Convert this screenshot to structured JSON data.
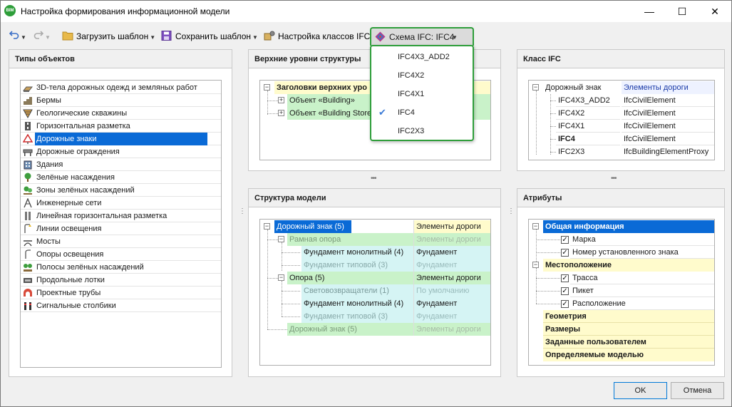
{
  "window": {
    "title": "Настройка формирования информационной модели",
    "app_badge": "BIM",
    "minimize": "—",
    "maximize": "☐",
    "close": "✕"
  },
  "toolbar": {
    "load_template": "Загрузить шаблон",
    "save_template": "Сохранить шаблон",
    "class_settings": "Настройка классов IFC",
    "schema_button": "Схема IFC: IFC4"
  },
  "schema_menu": {
    "items": [
      "IFC4X3_ADD2",
      "IFC4X2",
      "IFC4X1",
      "IFC4",
      "IFC2X3"
    ],
    "checked": "IFC4"
  },
  "object_types": {
    "title": "Типы объектов",
    "items": [
      "3D-тела дорожных одежд и земляных работ",
      "Бермы",
      "Геологические скважины",
      "Горизонтальная разметка",
      "Дорожные знаки",
      "Дорожные ограждения",
      "Здания",
      "Зелёные насаждения",
      "Зоны зелёных насаждений",
      "Инженерные сети",
      "Линейная горизонтальная разметка",
      "Линии освещения",
      "Мосты",
      "Опоры освещения",
      "Полосы зелёных насаждений",
      "Продольные лотки",
      "Проектные трубы",
      "Сигнальные столбики"
    ],
    "selected": "Дорожные знаки"
  },
  "upper_levels": {
    "title": "Верхние уровни структуры",
    "root": "Заголовки верхних уро",
    "children": [
      "Объект «Building»",
      "Объект «Building Store"
    ]
  },
  "ifc_class": {
    "title": "Класс IFC",
    "root_name": "Дорожный знак",
    "root_value": "Элементы дороги",
    "rows": [
      {
        "schema": "IFC4X3_ADD2",
        "cls": "IfcCivilElement"
      },
      {
        "schema": "IFC4X2",
        "cls": "IfcCivilElement"
      },
      {
        "schema": "IFC4X1",
        "cls": "IfcCivilElement"
      },
      {
        "schema": "IFC4",
        "cls": "IfcCivilElement"
      },
      {
        "schema": "IFC2X3",
        "cls": "IfcBuildingElementProxy"
      }
    ]
  },
  "model_structure": {
    "title": "Структура модели",
    "rows": [
      {
        "name": "Дорожный знак (5)",
        "value": "Элементы дороги"
      },
      {
        "name": "Рамная опора",
        "value": "Элементы дороги"
      },
      {
        "name": "Фундамент монолитный (4)",
        "value": "Фундамент"
      },
      {
        "name": "Фундамент типовой (3)",
        "value": "Фундамент"
      },
      {
        "name": "Опора (5)",
        "value": "Элементы дороги"
      },
      {
        "name": "Световозвращатели (1)",
        "value": "По умолчанию"
      },
      {
        "name": "Фундамент монолитный (4)",
        "value": "Фундамент"
      },
      {
        "name": "Фундамент типовой (3)",
        "value": "Фундамент"
      },
      {
        "name": "Дорожный знак (5)",
        "value": "Элементы дороги"
      }
    ]
  },
  "attributes": {
    "title": "Атрибуты",
    "groups": [
      "Общая информация",
      "Местоположение",
      "Геометрия",
      "Размеры",
      "Заданные пользователем",
      "Определяемые моделью"
    ],
    "general_items": [
      "Марка",
      "Номер установленного знака"
    ],
    "location_items": [
      "Трасса",
      "Пикет",
      "Расположение"
    ]
  },
  "footer": {
    "ok": "OK",
    "cancel": "Отмена"
  },
  "colors": {
    "selection": "#0a6ad6",
    "yellow_row": "#fffbcc",
    "green_row": "#c9f2c9",
    "cyan_row": "#d5f4f4",
    "highlight_border": "#2e9e3a"
  }
}
